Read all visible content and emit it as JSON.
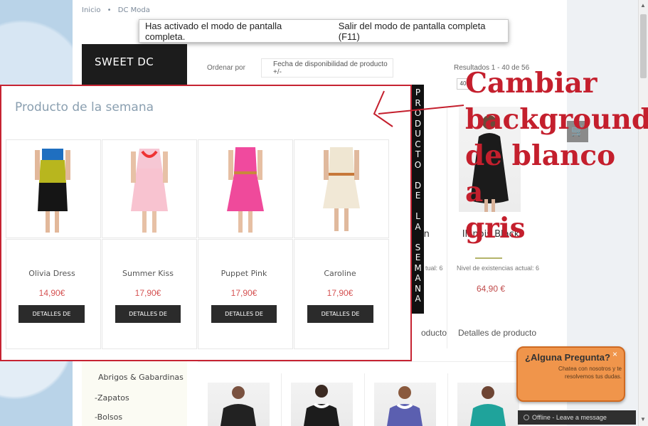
{
  "breadcrumb": {
    "home": "Inicio",
    "sep": "•",
    "current": "DC Moda"
  },
  "fullscreen_banner": {
    "message": "Has activado el modo de pantalla completa.",
    "exit": "Salir del modo de pantalla completa (F11)"
  },
  "sidebar": {
    "brand": "SWEET DC",
    "items": [
      "Abrigos & Gabardinas",
      "-Zapatos",
      "-Bolsos"
    ]
  },
  "sort": {
    "label": "Ordenar por",
    "value": "Fecha de disponibilidad de producto +/-"
  },
  "results": {
    "text": "Resultados 1 - 40 de 56",
    "per_page": "40"
  },
  "popup": {
    "title": "Producto de la semana",
    "tab_label": "PRODUCTO DE LA SEMANA",
    "products": [
      {
        "name": "Olivia Dress",
        "price": "14,90€",
        "button": "DETALLES DE PRODUCTO"
      },
      {
        "name": "Summer Kiss",
        "price": "17,90€",
        "button": "DETALLES DE PRODUCTO"
      },
      {
        "name": "Puppet Pink",
        "price": "17,90€",
        "button": "DETALLES DE PRODUCTO"
      },
      {
        "name": "Caroline",
        "price": "17,90€",
        "button": "DETALLES DE PRODUCTO"
      }
    ]
  },
  "background_products": {
    "partial_name": "in",
    "partial_stock": "tual: 6",
    "partial_details": "oducto",
    "right": {
      "name": "Illinois Black",
      "stock": "Nivel de existencias actual: 6",
      "price": "64,90 €",
      "details": "Detalles de producto"
    }
  },
  "annotation": {
    "lines": [
      "Cambiar",
      "background",
      "de blanco a",
      "gris"
    ]
  },
  "chat": {
    "title": "¿Alguna Pregunta?",
    "close": "×",
    "subtitle": "Chatea con nosotros y te resolvemos tus dudas.",
    "status": "Offline - Leave a message"
  },
  "icons": {
    "cart": "shopping-cart-icon",
    "arrow": "arrow-annotation-icon"
  },
  "colors": {
    "accent_red": "#c41f2d",
    "price_red": "#d55353",
    "dark": "#1c1c1c"
  }
}
